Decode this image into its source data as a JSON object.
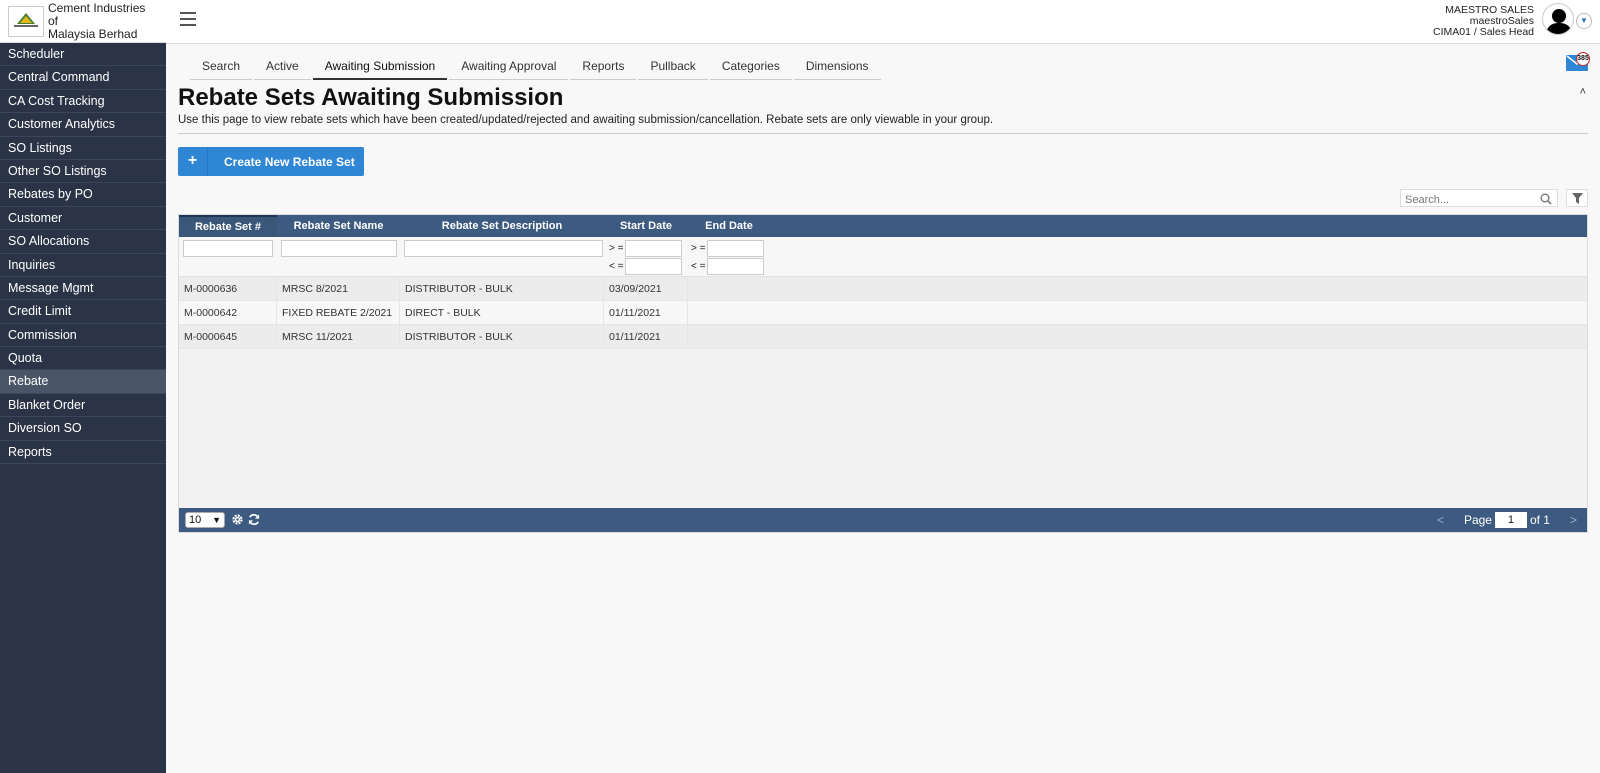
{
  "brand": {
    "name_line1": "Cement Industries of",
    "name_line2": "Malaysia Berhad"
  },
  "sidebar": {
    "items": [
      {
        "label": "Scheduler"
      },
      {
        "label": "Central Command"
      },
      {
        "label": "CA Cost Tracking"
      },
      {
        "label": "Customer Analytics"
      },
      {
        "label": "SO Listings"
      },
      {
        "label": "Other SO Listings"
      },
      {
        "label": "Rebates by PO"
      },
      {
        "label": "Customer"
      },
      {
        "label": "SO Allocations"
      },
      {
        "label": "Inquiries"
      },
      {
        "label": "Message Mgmt"
      },
      {
        "label": "Credit Limit"
      },
      {
        "label": "Commission"
      },
      {
        "label": "Quota"
      },
      {
        "label": "Rebate",
        "active": true
      },
      {
        "label": "Blanket Order"
      },
      {
        "label": "Diversion SO"
      },
      {
        "label": "Reports"
      }
    ]
  },
  "user": {
    "display_name": "MAESTRO SALES",
    "username": "maestroSales",
    "role": "CIMA01 / Sales Head"
  },
  "tabs": [
    {
      "label": "Search"
    },
    {
      "label": "Active"
    },
    {
      "label": "Awaiting Submission",
      "active": true
    },
    {
      "label": "Awaiting Approval"
    },
    {
      "label": "Reports"
    },
    {
      "label": "Pullback"
    },
    {
      "label": "Categories"
    },
    {
      "label": "Dimensions"
    }
  ],
  "notifications": {
    "count": "385"
  },
  "page": {
    "title": "Rebate Sets Awaiting Submission",
    "description": "Use this page to view rebate sets which have been created/updated/rejected and awaiting submission/cancellation. Rebate sets are only viewable in your group."
  },
  "create_button": {
    "label": "Create New Rebate Set"
  },
  "search": {
    "placeholder": "Search..."
  },
  "grid": {
    "columns": [
      {
        "label": "Rebate Set #"
      },
      {
        "label": "Rebate Set Name"
      },
      {
        "label": "Rebate Set Description"
      },
      {
        "label": "Start Date"
      },
      {
        "label": "End Date"
      }
    ],
    "filter_ops": {
      "gte": "> =",
      "lte": "< ="
    },
    "rows": [
      {
        "set_no": "M-0000636",
        "name": "MRSC 8/2021",
        "description": "DISTRIBUTOR - BULK",
        "start_date": "03/09/2021",
        "end_date": ""
      },
      {
        "set_no": "M-0000642",
        "name": "FIXED REBATE 2/2021",
        "description": "DIRECT - BULK",
        "start_date": "01/11/2021",
        "end_date": ""
      },
      {
        "set_no": "M-0000645",
        "name": "MRSC 11/2021",
        "description": "DISTRIBUTOR - BULK",
        "start_date": "01/11/2021",
        "end_date": ""
      }
    ],
    "footer": {
      "page_size": "10",
      "prev": "<",
      "next": ">",
      "page_label": "Page",
      "current_page": "1",
      "of_label": "of 1"
    }
  },
  "colors": {
    "sidebar_bg": "#2a3446",
    "grid_header_bg": "#3d5a80",
    "primary_button": "#2e86d4"
  }
}
